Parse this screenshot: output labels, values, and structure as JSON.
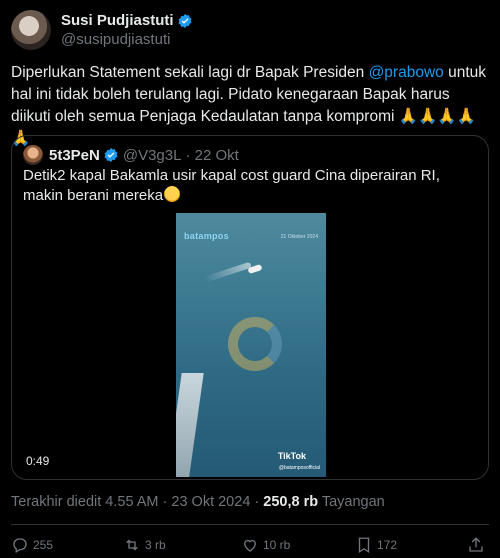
{
  "author": {
    "display_name": "Susi Pudjiastuti",
    "handle": "@susipudjiastuti"
  },
  "tweet": {
    "text_1": "Diperlukan Statement sekali lagi dr Bapak Presiden ",
    "mention": "@prabowo",
    "text_2": " untuk hal ini tidak boleh terulang lagi. Pidato kenegaraan Bapak harus diikuti oleh semua Penjaga Kedaulatan tanpa kompromi ",
    "emojis": "🙏🙏🙏🙏🙏"
  },
  "quote": {
    "display_name": "5t3PeN",
    "handle": "@V3g3L",
    "date": "· 22 Okt",
    "text": "Detik2 kapal Bakamla usir kapal cost guard Cina diperairan RI, makin berani mereka",
    "video": {
      "logo": "batampos",
      "date_overlay": "21 Oktober 2024",
      "tiktok": "TikTok",
      "tiktok_handle": "@batamposofficial",
      "duration": "0:49"
    }
  },
  "meta": {
    "edited": "Terakhir diedit 4.55 AM · 23 Okt 2024 · ",
    "views": "250,8 rb",
    "views_label": " Tayangan"
  },
  "actions": {
    "reply_count": "255",
    "repost_count": "3 rb",
    "like_count": "10 rb",
    "bookmark_count": "172"
  },
  "colors": {
    "accent": "#1d9bf0",
    "muted": "#71767b",
    "text": "#e7e9ea",
    "border": "#2f3336"
  }
}
